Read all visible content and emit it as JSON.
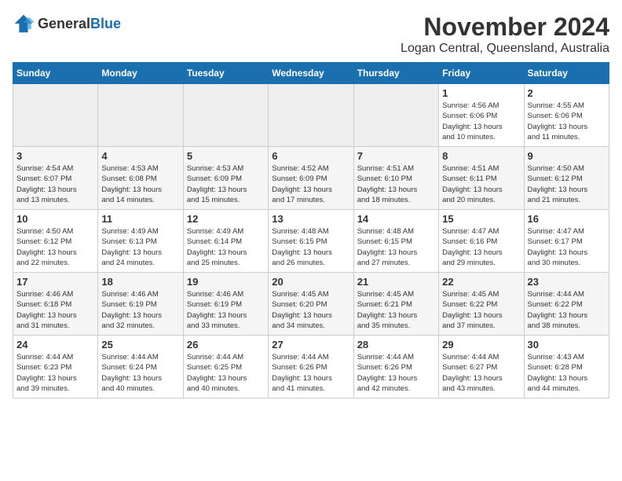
{
  "header": {
    "logo_general": "General",
    "logo_blue": "Blue",
    "month_title": "November 2024",
    "location": "Logan Central, Queensland, Australia"
  },
  "weekdays": [
    "Sunday",
    "Monday",
    "Tuesday",
    "Wednesday",
    "Thursday",
    "Friday",
    "Saturday"
  ],
  "weeks": [
    [
      {
        "day": "",
        "info": ""
      },
      {
        "day": "",
        "info": ""
      },
      {
        "day": "",
        "info": ""
      },
      {
        "day": "",
        "info": ""
      },
      {
        "day": "",
        "info": ""
      },
      {
        "day": "1",
        "info": "Sunrise: 4:56 AM\nSunset: 6:06 PM\nDaylight: 13 hours\nand 10 minutes."
      },
      {
        "day": "2",
        "info": "Sunrise: 4:55 AM\nSunset: 6:06 PM\nDaylight: 13 hours\nand 11 minutes."
      }
    ],
    [
      {
        "day": "3",
        "info": "Sunrise: 4:54 AM\nSunset: 6:07 PM\nDaylight: 13 hours\nand 13 minutes."
      },
      {
        "day": "4",
        "info": "Sunrise: 4:53 AM\nSunset: 6:08 PM\nDaylight: 13 hours\nand 14 minutes."
      },
      {
        "day": "5",
        "info": "Sunrise: 4:53 AM\nSunset: 6:09 PM\nDaylight: 13 hours\nand 15 minutes."
      },
      {
        "day": "6",
        "info": "Sunrise: 4:52 AM\nSunset: 6:09 PM\nDaylight: 13 hours\nand 17 minutes."
      },
      {
        "day": "7",
        "info": "Sunrise: 4:51 AM\nSunset: 6:10 PM\nDaylight: 13 hours\nand 18 minutes."
      },
      {
        "day": "8",
        "info": "Sunrise: 4:51 AM\nSunset: 6:11 PM\nDaylight: 13 hours\nand 20 minutes."
      },
      {
        "day": "9",
        "info": "Sunrise: 4:50 AM\nSunset: 6:12 PM\nDaylight: 13 hours\nand 21 minutes."
      }
    ],
    [
      {
        "day": "10",
        "info": "Sunrise: 4:50 AM\nSunset: 6:12 PM\nDaylight: 13 hours\nand 22 minutes."
      },
      {
        "day": "11",
        "info": "Sunrise: 4:49 AM\nSunset: 6:13 PM\nDaylight: 13 hours\nand 24 minutes."
      },
      {
        "day": "12",
        "info": "Sunrise: 4:49 AM\nSunset: 6:14 PM\nDaylight: 13 hours\nand 25 minutes."
      },
      {
        "day": "13",
        "info": "Sunrise: 4:48 AM\nSunset: 6:15 PM\nDaylight: 13 hours\nand 26 minutes."
      },
      {
        "day": "14",
        "info": "Sunrise: 4:48 AM\nSunset: 6:15 PM\nDaylight: 13 hours\nand 27 minutes."
      },
      {
        "day": "15",
        "info": "Sunrise: 4:47 AM\nSunset: 6:16 PM\nDaylight: 13 hours\nand 29 minutes."
      },
      {
        "day": "16",
        "info": "Sunrise: 4:47 AM\nSunset: 6:17 PM\nDaylight: 13 hours\nand 30 minutes."
      }
    ],
    [
      {
        "day": "17",
        "info": "Sunrise: 4:46 AM\nSunset: 6:18 PM\nDaylight: 13 hours\nand 31 minutes."
      },
      {
        "day": "18",
        "info": "Sunrise: 4:46 AM\nSunset: 6:19 PM\nDaylight: 13 hours\nand 32 minutes."
      },
      {
        "day": "19",
        "info": "Sunrise: 4:46 AM\nSunset: 6:19 PM\nDaylight: 13 hours\nand 33 minutes."
      },
      {
        "day": "20",
        "info": "Sunrise: 4:45 AM\nSunset: 6:20 PM\nDaylight: 13 hours\nand 34 minutes."
      },
      {
        "day": "21",
        "info": "Sunrise: 4:45 AM\nSunset: 6:21 PM\nDaylight: 13 hours\nand 35 minutes."
      },
      {
        "day": "22",
        "info": "Sunrise: 4:45 AM\nSunset: 6:22 PM\nDaylight: 13 hours\nand 37 minutes."
      },
      {
        "day": "23",
        "info": "Sunrise: 4:44 AM\nSunset: 6:22 PM\nDaylight: 13 hours\nand 38 minutes."
      }
    ],
    [
      {
        "day": "24",
        "info": "Sunrise: 4:44 AM\nSunset: 6:23 PM\nDaylight: 13 hours\nand 39 minutes."
      },
      {
        "day": "25",
        "info": "Sunrise: 4:44 AM\nSunset: 6:24 PM\nDaylight: 13 hours\nand 40 minutes."
      },
      {
        "day": "26",
        "info": "Sunrise: 4:44 AM\nSunset: 6:25 PM\nDaylight: 13 hours\nand 40 minutes."
      },
      {
        "day": "27",
        "info": "Sunrise: 4:44 AM\nSunset: 6:26 PM\nDaylight: 13 hours\nand 41 minutes."
      },
      {
        "day": "28",
        "info": "Sunrise: 4:44 AM\nSunset: 6:26 PM\nDaylight: 13 hours\nand 42 minutes."
      },
      {
        "day": "29",
        "info": "Sunrise: 4:44 AM\nSunset: 6:27 PM\nDaylight: 13 hours\nand 43 minutes."
      },
      {
        "day": "30",
        "info": "Sunrise: 4:43 AM\nSunset: 6:28 PM\nDaylight: 13 hours\nand 44 minutes."
      }
    ]
  ]
}
